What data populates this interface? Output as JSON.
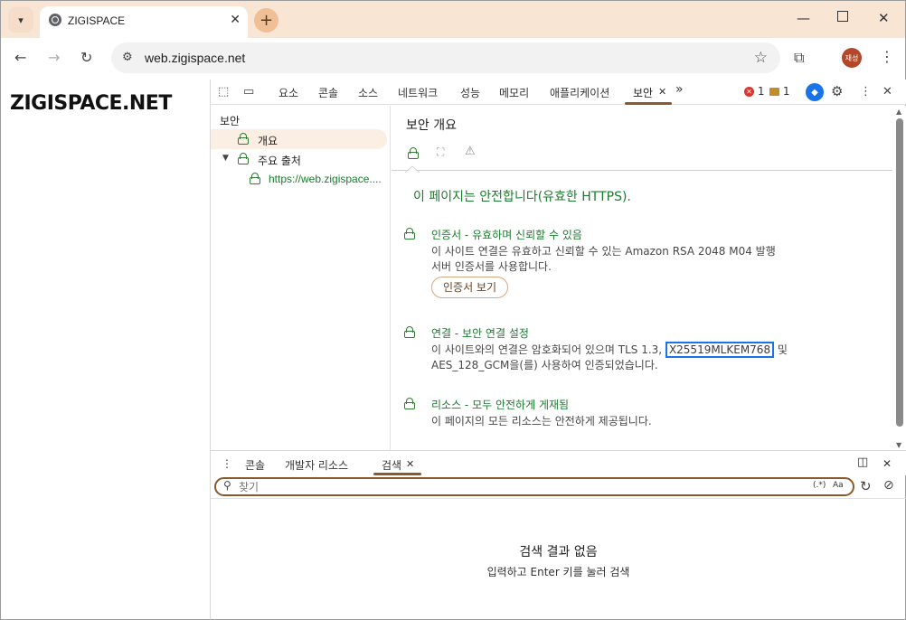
{
  "browser": {
    "tab_menu_icon": "chevron-down-icon",
    "tab_title": "ZIGISPACE",
    "tab_close": "✕",
    "new_tab": "+",
    "url": "web.zigispace.net",
    "avatar_text": "재성"
  },
  "page": {
    "heading": "ZIGISPACE.NET"
  },
  "devtools": {
    "tabs": [
      "요소",
      "콘솔",
      "소스",
      "네트워크",
      "성능",
      "메모리",
      "애플리케이션",
      "보안"
    ],
    "active_tab_close": "✕",
    "more_tabs": "»",
    "error_count": "1",
    "warning_count": "1",
    "sidebar": {
      "heading": "보안",
      "overview": "개요",
      "main_origin": "주요 출처",
      "origin_url": "https://web.zigispace...."
    },
    "main": {
      "title": "보안 개요",
      "summary": "이 페이지는 안전합니다(유효한 HTTPS).",
      "certificate": {
        "title": "인증서 - 유효하며 신뢰할 수 있음",
        "desc_line1": "이 사이트 연결은 유효하고 신뢰할 수 있는 Amazon RSA 2048 M04 발행",
        "desc_line2": "서버 인증서를 사용합니다.",
        "button": "인증서 보기"
      },
      "connection": {
        "title": "연결 - 보안 연결 설정",
        "desc_pre": "이 사이트와의 연결은 암호화되어 있으며 TLS 1.3,",
        "desc_highlight": "X25519MLKEM768",
        "desc_post": "및",
        "desc_line2": "AES_128_GCM을(를) 사용하여 인증되었습니다."
      },
      "resources": {
        "title": "리소스 - 모두 안전하게 게재됨",
        "desc": "이 페이지의 모든 리소스는 안전하게 제공됩니다."
      }
    },
    "drawer": {
      "tabs": [
        "콘솔",
        "개발자 리소스",
        "검색"
      ],
      "active_close": "✕",
      "search_placeholder": "찾기",
      "regex_label": "(.*)",
      "case_label": "Aa",
      "no_results": "검색 결과 없음",
      "no_results_hint": "입력하고 Enter 키를 눌러 검색"
    }
  }
}
